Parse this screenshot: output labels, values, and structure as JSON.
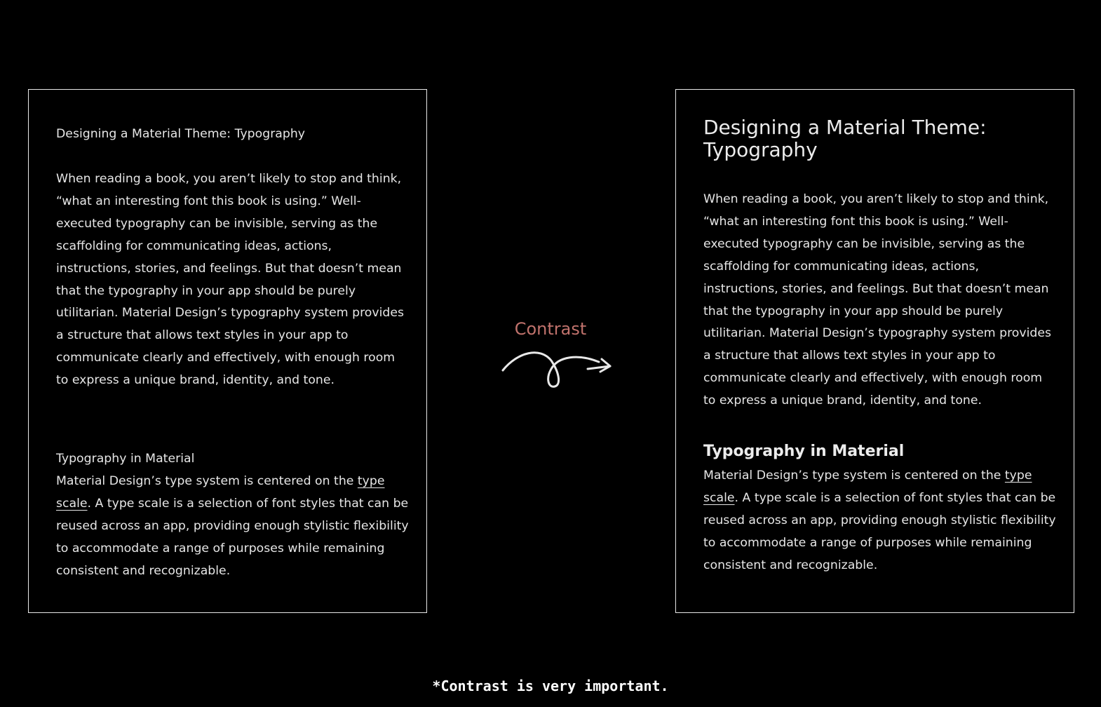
{
  "before_card": {
    "title": "Designing a Material Theme: Typography",
    "paragraph1": "When reading a book, you aren’t likely to stop and think, “what an interesting font this book is using.” Well-executed typography can be invisible, serving as the scaffolding for communicating ideas, actions, instructions, stories, and feelings. But that doesn’t mean that the typography in your app should be purely utilitarian. Material Design’s typography system provides a structure that allows text styles in your app to communicate clearly and effectively, with enough room to express a unique brand, identity, and tone.",
    "subtitle": "Typography in Material",
    "paragraph2_pre": "Material Design’s type system is centered on the ",
    "paragraph2_link": "type scale",
    "paragraph2_post": ". A type scale is a selection of font styles that can be reused across an app, providing enough stylistic flexibility to accommodate a range of purposes while remaining consistent and recognizable."
  },
  "after_card": {
    "title": "Designing a Material Theme: Typography",
    "paragraph1": "When reading a book, you aren’t likely to stop and think, “what an interesting font this book is using.” Well-executed typography can be invisible, serving as the scaffolding for communicating ideas, actions, instructions, stories, and feelings. But that doesn’t mean that the typography in your app should be purely utilitarian. Material Design’s typography system provides a structure that allows text styles in your app to communicate clearly and effectively, with enough room to express a unique brand, identity, and tone.",
    "subtitle": "Typography in Material",
    "paragraph2_pre": "Material Design’s type system is centered on the ",
    "paragraph2_link": "type scale",
    "paragraph2_post": ". A type scale is a selection of font styles that can be reused across an app, providing enough stylistic flexibility to accommodate a range of purposes while remaining consistent and recognizable."
  },
  "transition": {
    "label": "Contrast",
    "icon": "loop-arrow-icon"
  },
  "footnote": "*Contrast is very important.",
  "colors": {
    "background": "#000000",
    "text": "#e6e6e6",
    "border": "#e8e8e8",
    "accent": "#c0726c"
  }
}
